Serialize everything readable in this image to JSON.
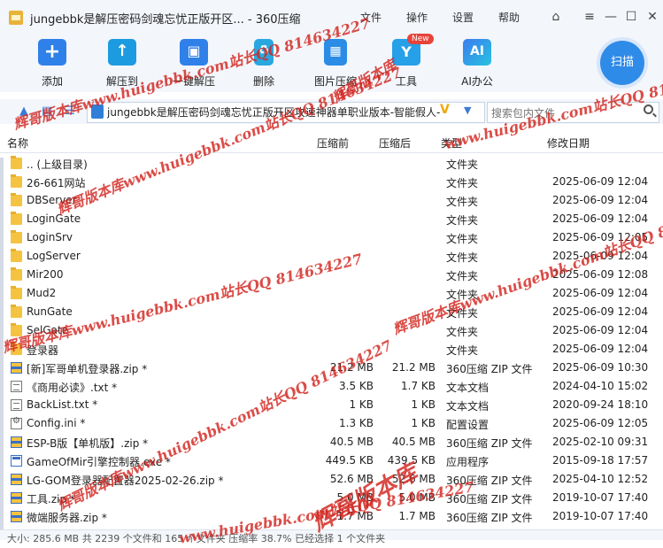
{
  "window": {
    "title": "jungebbk是解压密码剑魂忘忧正版开区... - 360压缩",
    "menu": [
      "文件",
      "操作",
      "设置",
      "帮助"
    ]
  },
  "toolbar": {
    "buttons": [
      {
        "label": "添加",
        "icon": "add-icon"
      },
      {
        "label": "解压到",
        "icon": "extract-to-icon"
      },
      {
        "label": "一键解压",
        "icon": "one-click-extract-icon"
      },
      {
        "label": "删除",
        "icon": "delete-icon"
      },
      {
        "label": "图片压缩",
        "icon": "image-compress-icon"
      },
      {
        "label": "工具",
        "icon": "tools-icon"
      },
      {
        "label": "AI办公",
        "icon": "ai-office-icon"
      }
    ],
    "new_badge": "New",
    "scan_label": "扫描"
  },
  "address": {
    "path": "jungebbk是解压密码剑魂忘忧正版开区攻速神器单职业版本-智能假人-",
    "search_placeholder": "搜索包内文件"
  },
  "columns": {
    "name": "名称",
    "size": "压缩前",
    "packed": "压缩后",
    "type": "类型",
    "date": "修改日期"
  },
  "files": [
    {
      "name": ".. (上级目录)",
      "size": "",
      "packed": "",
      "type": "文件夹",
      "date": "",
      "icon": "folder"
    },
    {
      "name": "26-661网站",
      "size": "",
      "packed": "",
      "type": "文件夹",
      "date": "2025-06-09 12:04",
      "icon": "folder"
    },
    {
      "name": "DBServer",
      "size": "",
      "packed": "",
      "type": "文件夹",
      "date": "2025-06-09 12:04",
      "icon": "folder"
    },
    {
      "name": "LoginGate",
      "size": "",
      "packed": "",
      "type": "文件夹",
      "date": "2025-06-09 12:04",
      "icon": "folder"
    },
    {
      "name": "LoginSrv",
      "size": "",
      "packed": "",
      "type": "文件夹",
      "date": "2025-06-09 12:05",
      "icon": "folder"
    },
    {
      "name": "LogServer",
      "size": "",
      "packed": "",
      "type": "文件夹",
      "date": "2025-06-09 12:04",
      "icon": "folder"
    },
    {
      "name": "Mir200",
      "size": "",
      "packed": "",
      "type": "文件夹",
      "date": "2025-06-09 12:08",
      "icon": "folder"
    },
    {
      "name": "Mud2",
      "size": "",
      "packed": "",
      "type": "文件夹",
      "date": "2025-06-09 12:04",
      "icon": "folder"
    },
    {
      "name": "RunGate",
      "size": "",
      "packed": "",
      "type": "文件夹",
      "date": "2025-06-09 12:04",
      "icon": "folder"
    },
    {
      "name": "SelGate",
      "size": "",
      "packed": "",
      "type": "文件夹",
      "date": "2025-06-09 12:04",
      "icon": "folder"
    },
    {
      "name": "登录器",
      "size": "",
      "packed": "",
      "type": "文件夹",
      "date": "2025-06-09 12:04",
      "icon": "folder"
    },
    {
      "name": "[新]军哥单机登录器.zip *",
      "size": "21.2 MB",
      "packed": "21.2 MB",
      "type": "360压缩 ZIP 文件",
      "date": "2025-06-09 10:30",
      "icon": "zip"
    },
    {
      "name": "《商用必读》.txt *",
      "size": "3.5 KB",
      "packed": "1.7 KB",
      "type": "文本文档",
      "date": "2024-04-10 15:02",
      "icon": "text"
    },
    {
      "name": "BackList.txt *",
      "size": "1 KB",
      "packed": "1 KB",
      "type": "文本文档",
      "date": "2020-09-24 18:10",
      "icon": "text"
    },
    {
      "name": "Config.ini *",
      "size": "1.3 KB",
      "packed": "1 KB",
      "type": "配置设置",
      "date": "2025-06-09 12:05",
      "icon": "config"
    },
    {
      "name": "ESP-B版【单机版】.zip *",
      "size": "40.5 MB",
      "packed": "40.5 MB",
      "type": "360压缩 ZIP 文件",
      "date": "2025-02-10 09:31",
      "icon": "zip"
    },
    {
      "name": "GameOfMir引擎控制器.exe *",
      "size": "449.5 KB",
      "packed": "439.5 KB",
      "type": "应用程序",
      "date": "2015-09-18 17:57",
      "icon": "exe"
    },
    {
      "name": "LG-GOM登录器配置器2025-02-26.zip *",
      "size": "52.6 MB",
      "packed": "52.6 MB",
      "type": "360压缩 ZIP 文件",
      "date": "2025-04-10 12:52",
      "icon": "zip"
    },
    {
      "name": "工具.zip *",
      "size": "5.0 MB",
      "packed": "5.0 MB",
      "type": "360压缩 ZIP 文件",
      "date": "2019-10-07 17:40",
      "icon": "zip"
    },
    {
      "name": "微端服务器.zip *",
      "size": "1.7 MB",
      "packed": "1.7 MB",
      "type": "360压缩 ZIP 文件",
      "date": "2019-10-07 17:40",
      "icon": "zip"
    }
  ],
  "status": "大小: 285.6 MB 共 2239 个文件和 165 个文件夹 压缩率 38.7% 已经选择 1 个文件夹",
  "watermarks": [
    "辉哥版本库www.huigebbk.com站长QQ 814634227",
    "辉哥版本库",
    "www.huigebbk.com站长QQ 814634227"
  ]
}
